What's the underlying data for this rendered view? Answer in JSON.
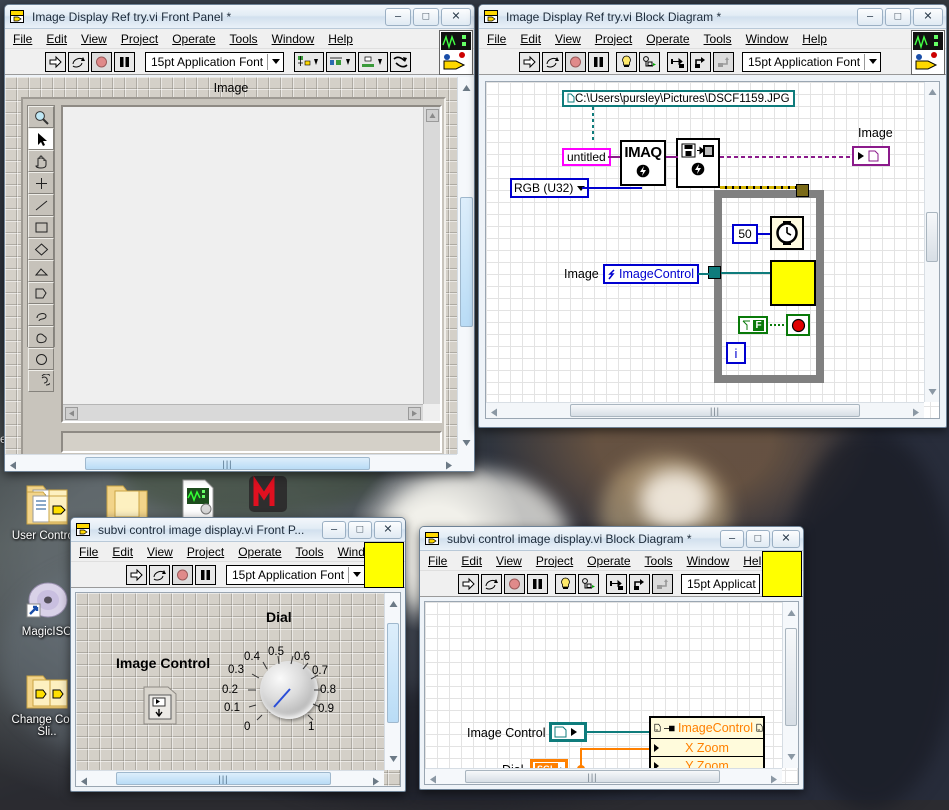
{
  "desktop": {
    "icons": [
      {
        "label": "User Controls",
        "glyph": "folder-vi-icon"
      },
      {
        "label": "MagicISO",
        "glyph": "disc-shortcut-icon"
      },
      {
        "label": "Change Color Sli..",
        "glyph": "folder-vi-icon"
      }
    ],
    "partial_label": "ead",
    "top_icons": [
      {
        "glyph": "folder-vi-icon"
      },
      {
        "glyph": "folder-icon"
      },
      {
        "glyph": "vi-document-icon"
      },
      {
        "glyph": "magiciso-m-icon"
      }
    ]
  },
  "menus": [
    "File",
    "Edit",
    "View",
    "Project",
    "Operate",
    "Tools",
    "Window",
    "Help"
  ],
  "window_buttons": {
    "minimize": "–",
    "maximize": "□",
    "close": "✕"
  },
  "fp_main": {
    "title": "Image Display Ref try.vi Front Panel *",
    "toolbar": {
      "font": "15pt Application Font",
      "buttons": [
        "run-icon",
        "run-continuous-icon",
        "abort-icon",
        "pause-icon"
      ],
      "align_menus": [
        "align-objects-icon",
        "distribute-objects-icon",
        "resize-objects-icon",
        "reorder-icon"
      ]
    },
    "image_label": "Image",
    "tools": [
      "zoom-tool-icon",
      "arrow-tool-icon",
      "pan-tool-icon",
      "point-tool-icon",
      "line-tool-icon",
      "rectangle-tool-icon",
      "rotated-rect-tool-icon",
      "polygon-tool-icon",
      "broken-line-tool-icon",
      "freehand-tool-icon",
      "blob-tool-icon",
      "oval-tool-icon",
      "annulus-tool-icon"
    ]
  },
  "bd_main": {
    "title": "Image Display Ref try.vi Block Diagram *",
    "toolbar": {
      "font": "15pt Application Font",
      "buttons": [
        "run-icon",
        "run-continuous-icon",
        "abort-icon",
        "pause-icon",
        "highlight-execution-icon",
        "retain-wire-values-icon",
        "step-into-icon",
        "step-over-icon",
        "step-out-icon"
      ]
    },
    "nodes": {
      "file_path": "C:\\Users\\pursley\\Pictures\\DSCF1159.JPG",
      "string_constant": "untitled",
      "image_type": "RGB (U32)",
      "imaq_create": "IMAQ",
      "imaq_readfile": "imaq-readfile-icon",
      "wait_ms": "50",
      "wait_node": "wait-ms-icon",
      "subvi_node": "subvi-yellow-icon",
      "false_constant": "F",
      "stop_button": "stop-button-icon",
      "loop_index": "i",
      "image_indicator_label": "Image",
      "image_control_label": "Image",
      "image_control_ref": "ImageControl"
    }
  },
  "fp_sub": {
    "title": "subvi control image display.vi Front P...",
    "toolbar": {
      "font": "15pt Application Font"
    },
    "image_control_label": "Image Control",
    "dial_label": "Dial",
    "dial_ticks": [
      "0",
      "0.1",
      "0.2",
      "0.3",
      "0.4",
      "0.5",
      "0.6",
      "0.7",
      "0.8",
      "0.9",
      "1"
    ],
    "dial_value": 0.22
  },
  "bd_sub": {
    "title": "subvi control image display.vi Block Diagram *",
    "toolbar": {
      "font": "15pt Applicat"
    },
    "image_control_label": "Image Control",
    "dial_label": "Dial",
    "dial_type": "SGL",
    "property_node": {
      "reference": "ImageControl",
      "properties": [
        "X Zoom",
        "Y Zoom"
      ]
    }
  },
  "colors": {
    "labview_yellow": "#ffff00",
    "wire_purple": "#8b1a8b",
    "wire_teal": "#0f7c7c",
    "wire_blue": "#0000d0",
    "wire_orange": "#ff8000",
    "constant_magenta": "#ff00ff",
    "loop_grey": "#808080",
    "prop_node_bg": "#fffbdc"
  }
}
